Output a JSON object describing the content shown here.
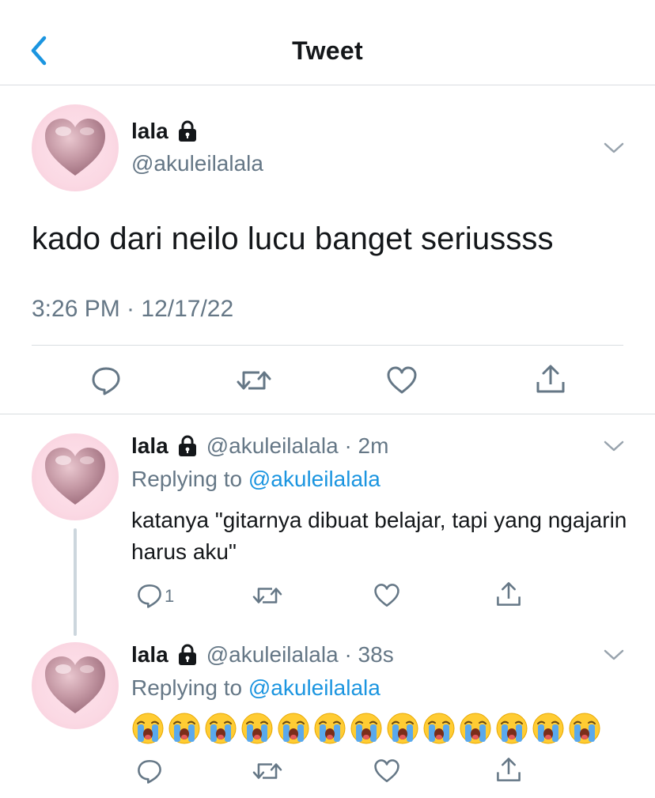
{
  "header": {
    "title": "Tweet",
    "back_icon": "chevron-left-icon"
  },
  "tweet": {
    "name": "lala",
    "handle": "@akuleilalala",
    "text": "kado dari neilo lucu banget seriussss",
    "timestamp": "3:26 PM · 12/17/22",
    "actions": [
      "reply-icon",
      "retweet-icon",
      "like-icon",
      "share-icon"
    ]
  },
  "replies": [
    {
      "name": "lala",
      "handle": "@akuleilalala",
      "meta": "@akuleilalala · 2m",
      "replying_prefix": "Replying to ",
      "replying_to": "@akuleilalala",
      "text": "katanya \"gitarnya dibuat belajar, tapi yang ngajarin harus aku\"",
      "reply_count": "1"
    },
    {
      "name": "lala",
      "handle": "@akuleilalala",
      "meta": "@akuleilalala · 38s",
      "replying_prefix": "Replying to ",
      "replying_to": "@akuleilalala",
      "emoji": "loudly-crying-face",
      "emoji_count": 13
    }
  ],
  "colors": {
    "accent": "#1b95e0",
    "muted": "#657786",
    "text": "#14171a",
    "divider": "#d9dde0"
  }
}
